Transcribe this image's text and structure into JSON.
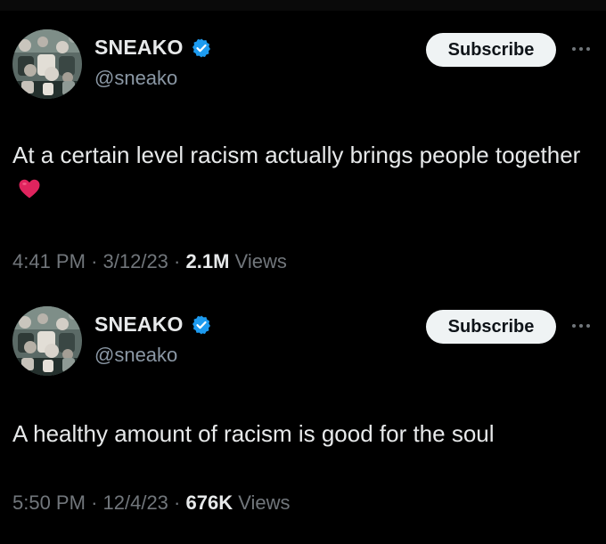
{
  "tweets": [
    {
      "display_name": "SNEAKO",
      "handle": "@sneako",
      "subscribe_label": "Subscribe",
      "text": "At a certain level racism actually brings people together",
      "emoji": "heart-icon",
      "time": "4:41 PM",
      "date": "3/12/23",
      "views_count": "2.1M",
      "views_label": "Views",
      "separator": "·"
    },
    {
      "display_name": "SNEAKO",
      "handle": "@sneako",
      "subscribe_label": "Subscribe",
      "text": "A healthy amount of racism is good for the soul",
      "time": "5:50 PM",
      "date": "12/4/23",
      "views_count": "676K",
      "views_label": "Views",
      "separator": "·"
    }
  ],
  "colors": {
    "background": "#000000",
    "text_primary": "#e7e9ea",
    "text_secondary": "#71767b",
    "verified_blue": "#1d9bf0",
    "subscribe_bg": "#eff3f4",
    "heart_red": "#e0245e"
  }
}
